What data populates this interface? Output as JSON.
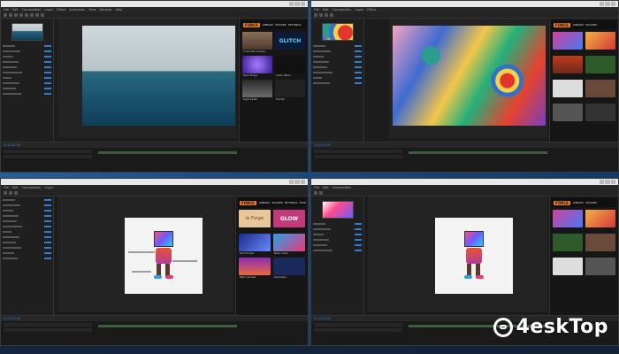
{
  "plugin": {
    "brand": "FORCE",
    "tabs": [
      "LIBRARY",
      "SHADER",
      "SETTINGS",
      "HELP"
    ]
  },
  "tiles": [
    {
      "label": "Cinematic Grades",
      "color": "#6b5a48"
    },
    {
      "label": "GLITCH",
      "color": "#0d1b3a"
    },
    {
      "label": "Neon Rings",
      "color": "#6a3ad0"
    },
    {
      "label": "Audio Wave",
      "color": "#111"
    },
    {
      "label": "Light Leaks",
      "color": "#c88a38"
    },
    {
      "label": "Fractal",
      "color": "#2b1f44"
    }
  ],
  "tiles_q3": [
    {
      "label": "le Forge",
      "color": "#e8c79a"
    },
    {
      "label": "GLOW",
      "color": "#c23a7a"
    },
    {
      "label": "Grid Tunnel",
      "color": "#2752d0"
    },
    {
      "label": "Neon Lines",
      "color": "#2ba0e8"
    },
    {
      "label": "Retro Sunset",
      "color": "#8a2ab8"
    },
    {
      "label": "Geometry",
      "color": "#1a2a5a"
    }
  ],
  "watermark": {
    "text": "4eskTop"
  },
  "menu_items": [
    "File",
    "Edit",
    "Composition",
    "Layer",
    "Effect",
    "Animation",
    "View",
    "Window",
    "Help"
  ],
  "timeline_label": "0:00:00:00"
}
